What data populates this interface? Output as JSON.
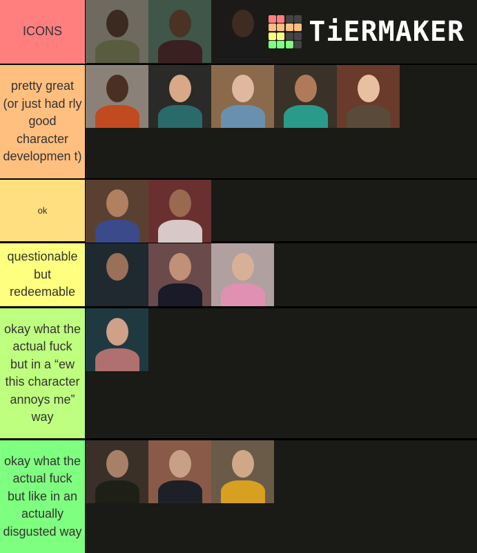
{
  "app": {
    "logo_text": "TiERMAKER"
  },
  "logo_grid_colors": [
    "#ff7f7f",
    "#ff7f7f",
    "#444444",
    "#444444",
    "#ffbf7f",
    "#ffbf7f",
    "#ffbf7f",
    "#ffbf7f",
    "#ffff7f",
    "#ffff7f",
    "#444444",
    "#444444",
    "#7fff7f",
    "#7fff7f",
    "#7fff7f",
    "#444444"
  ],
  "tiers": [
    {
      "label": "ICONS",
      "color": "#ff7f7f",
      "font_small": false,
      "items": [
        {
          "name": "character-1",
          "bg": "#6e6a60",
          "skin": "#3b2a20",
          "cloth": "#5a5c40"
        },
        {
          "name": "character-2",
          "bg": "#3f5648",
          "skin": "#4a3225",
          "cloth": "#3a2020"
        },
        {
          "name": "character-3",
          "bg": "#1c1a18",
          "skin": "#3e2b22",
          "cloth": "#1a1a1a"
        }
      ]
    },
    {
      "label": "pretty great (or just had rly good character developmen t)",
      "color": "#ffbf7f",
      "font_small": false,
      "items": [
        {
          "name": "character-4",
          "bg": "#8a8278",
          "skin": "#4a3022",
          "cloth": "#c24a20"
        },
        {
          "name": "character-5",
          "bg": "#2a2a28",
          "skin": "#d8a888",
          "cloth": "#2a6a6a"
        },
        {
          "name": "character-6",
          "bg": "#8a6a4a",
          "skin": "#e0b8a0",
          "cloth": "#6a90b0"
        },
        {
          "name": "character-7",
          "bg": "#3a3228",
          "skin": "#b07a5a",
          "cloth": "#2a9a8a"
        },
        {
          "name": "character-8",
          "bg": "#6a3a2a",
          "skin": "#e8c0a0",
          "cloth": "#5a4a3a"
        }
      ]
    },
    {
      "label": "ok",
      "color": "#ffdf7f",
      "font_small": true,
      "items": [
        {
          "name": "character-9",
          "bg": "#5a4030",
          "skin": "#b08060",
          "cloth": "#3a4a8a"
        },
        {
          "name": "character-10",
          "bg": "#6a3030",
          "skin": "#9a6a50",
          "cloth": "#d8c8c8"
        }
      ]
    },
    {
      "label": "questionable but redeemable",
      "color": "#ffff7f",
      "font_small": false,
      "items": [
        {
          "name": "character-11",
          "bg": "#1e2a30",
          "skin": "#9a7058",
          "cloth": "#202830"
        },
        {
          "name": "character-12",
          "bg": "#6a4a4a",
          "skin": "#c09078",
          "cloth": "#1a1a28"
        },
        {
          "name": "character-13",
          "bg": "#b0a0a0",
          "skin": "#d8b098",
          "cloth": "#e090b0"
        }
      ]
    },
    {
      "label": "okay what the actual fuck but in a “ew this character annoys me” way",
      "color": "#bfff7f",
      "font_small": false,
      "items": [
        {
          "name": "character-14",
          "bg": "#1e3a40",
          "skin": "#d0a088",
          "cloth": "#b07070"
        }
      ]
    },
    {
      "label": "okay what the actual fuck but like in an actually disgusted way",
      "color": "#7fff7f",
      "font_small": false,
      "items": [
        {
          "name": "character-15",
          "bg": "#3a3028",
          "skin": "#a88068",
          "cloth": "#1e2018"
        },
        {
          "name": "character-16",
          "bg": "#8a5a48",
          "skin": "#c8a088",
          "cloth": "#1e2028"
        },
        {
          "name": "character-17",
          "bg": "#6a5a48",
          "skin": "#d0a888",
          "cloth": "#d8a020"
        }
      ]
    }
  ]
}
